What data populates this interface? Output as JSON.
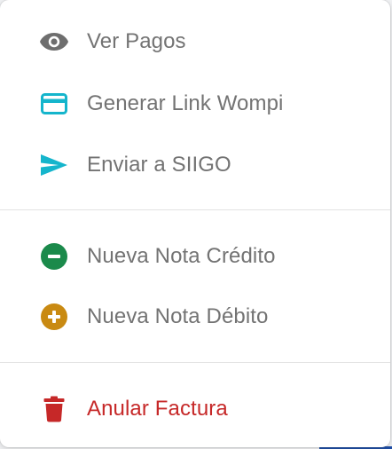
{
  "menu": {
    "groups": [
      {
        "items": [
          {
            "label": "Ver Pagos",
            "icon": "eye-icon",
            "color": "#6e6e6e"
          },
          {
            "label": "Generar Link Wompi",
            "icon": "credit-card-icon",
            "color": "#15b5cc"
          },
          {
            "label": "Enviar a SIIGO",
            "icon": "send-icon",
            "color": "#15b5cc"
          }
        ]
      },
      {
        "items": [
          {
            "label": "Nueva Nota Crédito",
            "icon": "minus-circle-icon",
            "color": "#1b8a4b"
          },
          {
            "label": "Nueva Nota Débito",
            "icon": "plus-circle-icon",
            "color": "#c98a12"
          }
        ]
      },
      {
        "items": [
          {
            "label": "Anular Factura",
            "icon": "trash-icon",
            "color": "#c62828"
          }
        ]
      }
    ]
  }
}
